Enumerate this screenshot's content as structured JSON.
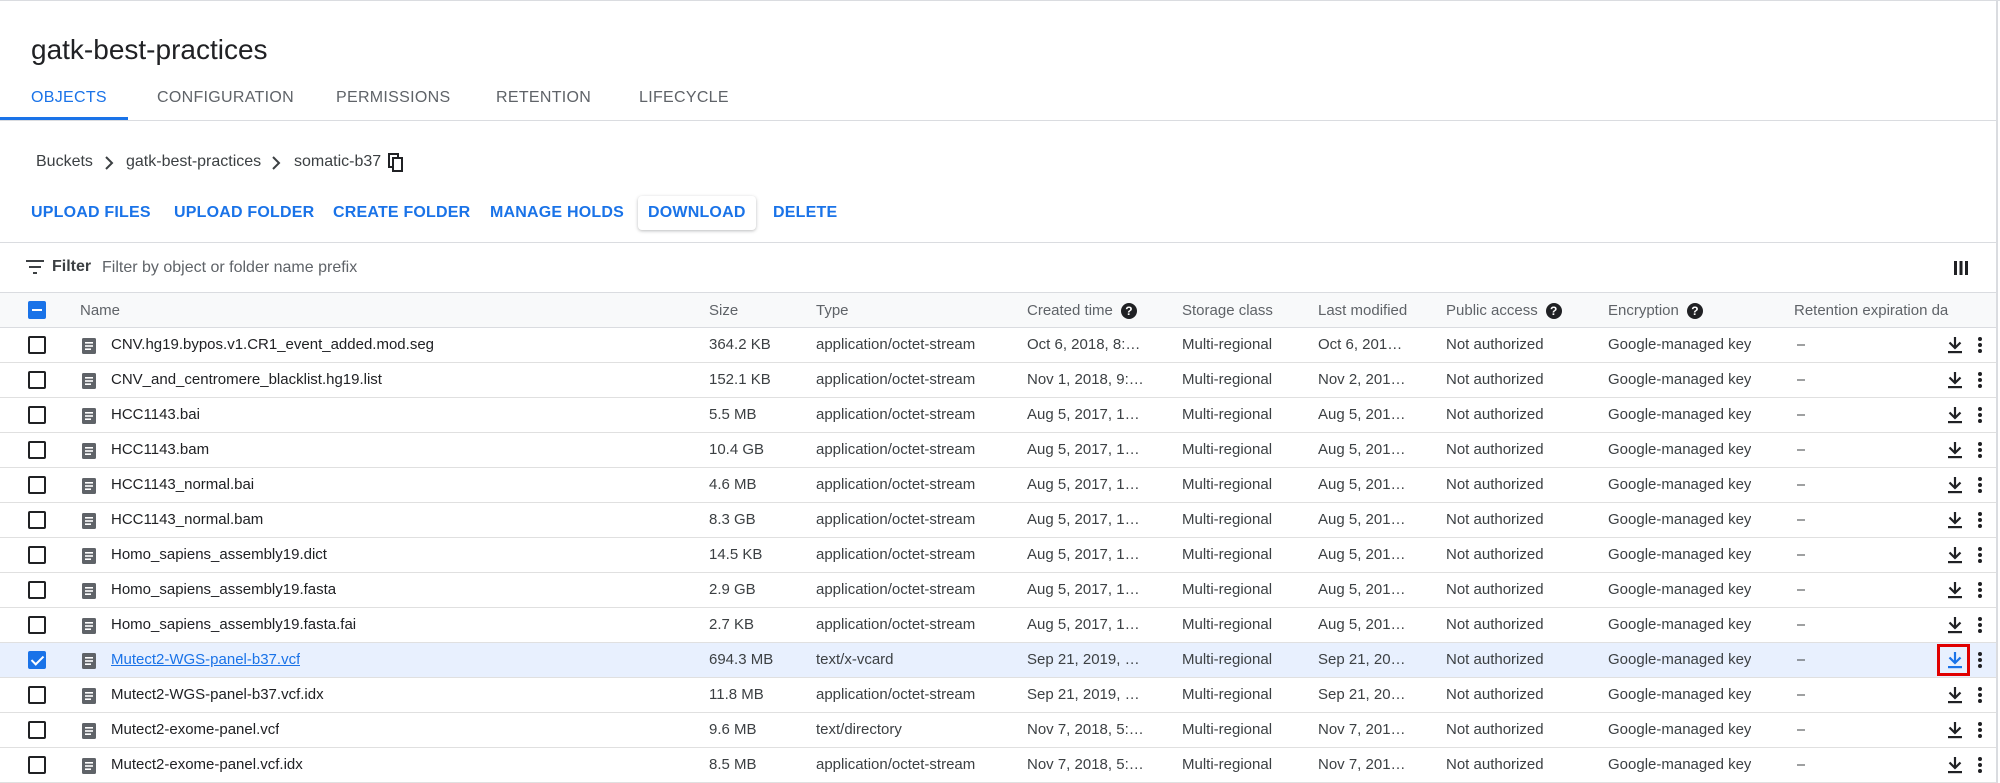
{
  "bucket": {
    "title": "gatk-best-practices"
  },
  "tabs": [
    {
      "label": "OBJECTS",
      "active": true
    },
    {
      "label": "CONFIGURATION",
      "active": false
    },
    {
      "label": "PERMISSIONS",
      "active": false
    },
    {
      "label": "RETENTION",
      "active": false
    },
    {
      "label": "LIFECYCLE",
      "active": false
    }
  ],
  "breadcrumb": {
    "items": [
      "Buckets",
      "gatk-best-practices",
      "somatic-b37"
    ],
    "separator_icon": "chevron-right-icon",
    "copy_icon": "copy-icon"
  },
  "actions": {
    "upload_files": "UPLOAD FILES",
    "upload_folder": "UPLOAD FOLDER",
    "create_folder": "CREATE FOLDER",
    "manage_holds": "MANAGE HOLDS",
    "download": "DOWNLOAD",
    "delete": "DELETE"
  },
  "filter": {
    "label": "Filter",
    "placeholder": "Filter by object or folder name prefix",
    "value": ""
  },
  "table": {
    "columns": {
      "name": "Name",
      "size": "Size",
      "type": "Type",
      "created": "Created time",
      "storage": "Storage class",
      "modified": "Last modified",
      "public": "Public access",
      "encryption": "Encryption",
      "retention": "Retention expiration da"
    },
    "header_help_glyph": "?",
    "rows": [
      {
        "name": "CNV.hg19.bypos.v1.CR1_event_added.mod.seg",
        "size": "364.2 KB",
        "type": "application/octet-stream",
        "created": "Oct 6, 2018, 8:…",
        "storage": "Multi-regional",
        "modified": "Oct 6, 201…",
        "public": "Not authorized",
        "encryption": "Google-managed key",
        "retention": "–",
        "checked": false
      },
      {
        "name": "CNV_and_centromere_blacklist.hg19.list",
        "size": "152.1 KB",
        "type": "application/octet-stream",
        "created": "Nov 1, 2018, 9:…",
        "storage": "Multi-regional",
        "modified": "Nov 2, 201…",
        "public": "Not authorized",
        "encryption": "Google-managed key",
        "retention": "–",
        "checked": false
      },
      {
        "name": "HCC1143.bai",
        "size": "5.5 MB",
        "type": "application/octet-stream",
        "created": "Aug 5, 2017, 1…",
        "storage": "Multi-regional",
        "modified": "Aug 5, 201…",
        "public": "Not authorized",
        "encryption": "Google-managed key",
        "retention": "–",
        "checked": false
      },
      {
        "name": "HCC1143.bam",
        "size": "10.4 GB",
        "type": "application/octet-stream",
        "created": "Aug 5, 2017, 1…",
        "storage": "Multi-regional",
        "modified": "Aug 5, 201…",
        "public": "Not authorized",
        "encryption": "Google-managed key",
        "retention": "–",
        "checked": false
      },
      {
        "name": "HCC1143_normal.bai",
        "size": "4.6 MB",
        "type": "application/octet-stream",
        "created": "Aug 5, 2017, 1…",
        "storage": "Multi-regional",
        "modified": "Aug 5, 201…",
        "public": "Not authorized",
        "encryption": "Google-managed key",
        "retention": "–",
        "checked": false
      },
      {
        "name": "HCC1143_normal.bam",
        "size": "8.3 GB",
        "type": "application/octet-stream",
        "created": "Aug 5, 2017, 1…",
        "storage": "Multi-regional",
        "modified": "Aug 5, 201…",
        "public": "Not authorized",
        "encryption": "Google-managed key",
        "retention": "–",
        "checked": false
      },
      {
        "name": "Homo_sapiens_assembly19.dict",
        "size": "14.5 KB",
        "type": "application/octet-stream",
        "created": "Aug 5, 2017, 1…",
        "storage": "Multi-regional",
        "modified": "Aug 5, 201…",
        "public": "Not authorized",
        "encryption": "Google-managed key",
        "retention": "–",
        "checked": false
      },
      {
        "name": "Homo_sapiens_assembly19.fasta",
        "size": "2.9 GB",
        "type": "application/octet-stream",
        "created": "Aug 5, 2017, 1…",
        "storage": "Multi-regional",
        "modified": "Aug 5, 201…",
        "public": "Not authorized",
        "encryption": "Google-managed key",
        "retention": "–",
        "checked": false
      },
      {
        "name": "Homo_sapiens_assembly19.fasta.fai",
        "size": "2.7 KB",
        "type": "application/octet-stream",
        "created": "Aug 5, 2017, 1…",
        "storage": "Multi-regional",
        "modified": "Aug 5, 201…",
        "public": "Not authorized",
        "encryption": "Google-managed key",
        "retention": "–",
        "checked": false
      },
      {
        "name": "Mutect2-WGS-panel-b37.vcf",
        "size": "694.3 MB",
        "type": "text/x-vcard",
        "created": "Sep 21, 2019, …",
        "storage": "Multi-regional",
        "modified": "Sep 21, 20…",
        "public": "Not authorized",
        "encryption": "Google-managed key",
        "retention": "–",
        "checked": true
      },
      {
        "name": "Mutect2-WGS-panel-b37.vcf.idx",
        "size": "11.8 MB",
        "type": "application/octet-stream",
        "created": "Sep 21, 2019, …",
        "storage": "Multi-regional",
        "modified": "Sep 21, 20…",
        "public": "Not authorized",
        "encryption": "Google-managed key",
        "retention": "–",
        "checked": false
      },
      {
        "name": "Mutect2-exome-panel.vcf",
        "size": "9.6 MB",
        "type": "text/directory",
        "created": "Nov 7, 2018, 5:…",
        "storage": "Multi-regional",
        "modified": "Nov 7, 201…",
        "public": "Not authorized",
        "encryption": "Google-managed key",
        "retention": "–",
        "checked": false
      },
      {
        "name": "Mutect2-exome-panel.vcf.idx",
        "size": "8.5 MB",
        "type": "application/octet-stream",
        "created": "Nov 7, 2018, 5:…",
        "storage": "Multi-regional",
        "modified": "Nov 7, 201…",
        "public": "Not authorized",
        "encryption": "Google-managed key",
        "retention": "–",
        "checked": false
      }
    ]
  },
  "colors": {
    "accent": "#1a73e8",
    "highlight_box": "#e00000",
    "selected_row": "#e8f0fe"
  }
}
